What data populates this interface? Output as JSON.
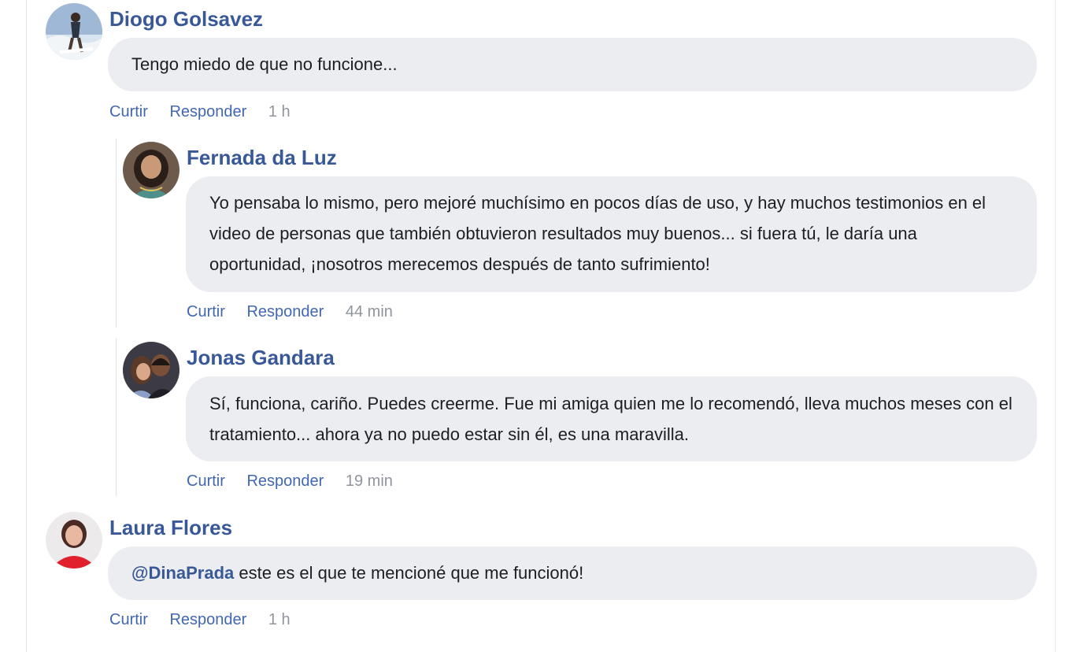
{
  "comments": [
    {
      "author": "Diogo Golsavez",
      "text": "Tengo miedo de que no funcione...",
      "like_label": "Curtir",
      "reply_label": "Responder",
      "time": "1 h",
      "avatar": "avatar-surfer"
    },
    {
      "author": "Fernada da Luz",
      "text": "Yo pensaba lo mismo, pero mejoré muchísimo en pocos días de uso, y hay muchos testimonios en el video de personas que también obtuvieron resultados muy buenos... si fuera tú, le daría una oportunidad, ¡nosotros merecemos después de tanto sufrimiento!",
      "like_label": "Curtir",
      "reply_label": "Responder",
      "time": "44 min",
      "avatar": "avatar-woman"
    },
    {
      "author": "Jonas Gandara",
      "text": "Sí, funciona, cariño. Puedes creerme. Fue mi amiga quien me lo recomendó, lleva muchos meses con el tratamiento... ahora ya no puedo estar sin él, es una maravilla.",
      "like_label": "Curtir",
      "reply_label": "Responder",
      "time": "19 min",
      "avatar": "avatar-couple"
    },
    {
      "author": "Laura Flores",
      "mention": "@DinaPrada",
      "text": " este es el que te mencioné que me funcionó!",
      "like_label": "Curtir",
      "reply_label": "Responder",
      "time": "1 h",
      "avatar": "avatar-woman-red"
    }
  ],
  "colors": {
    "author": "#385898",
    "link": "#4267b2",
    "bubble": "#ebedf0",
    "time": "#90949c",
    "text": "#1c1e21"
  }
}
